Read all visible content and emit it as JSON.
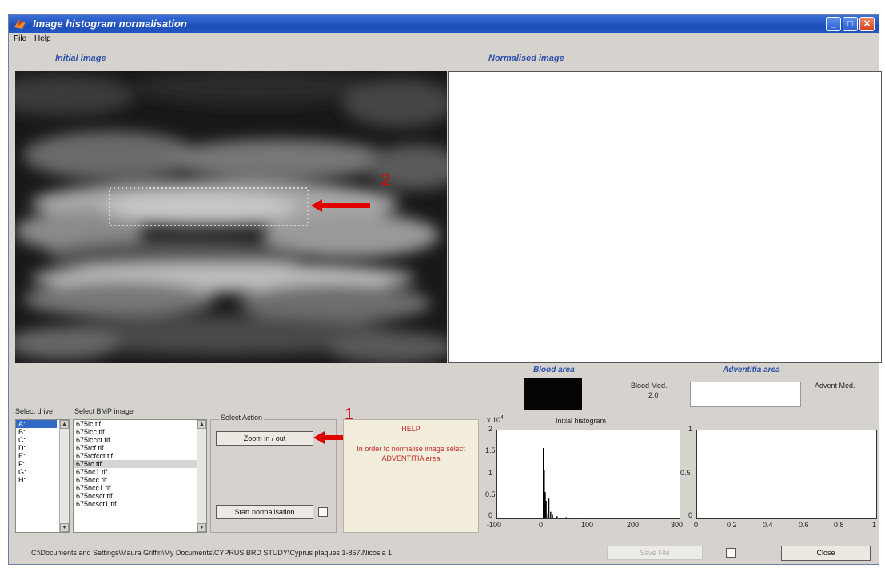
{
  "window": {
    "title": "Image histogram normalisation",
    "menu": [
      "File",
      "Help"
    ]
  },
  "panels": {
    "initial_label": "Initial image",
    "normalised_label": "Normalised image"
  },
  "annotations": {
    "one": "1",
    "two": "2"
  },
  "areas": {
    "blood_label": "Blood area",
    "adventitia_label": "Adventitia area",
    "blood_med_label": "Blood Med.",
    "blood_med_value": "2.0",
    "advent_med_label": "Advent Med."
  },
  "drive": {
    "label": "Select drive",
    "items": [
      "A:",
      "B:",
      "C:",
      "D:",
      "E:",
      "F:",
      "G:",
      "H:"
    ],
    "selected": "A:"
  },
  "bmp": {
    "label": "Select BMP image",
    "items": [
      "675lc.tif",
      "675lcc.tif",
      "675lccct.tif",
      "675rcf.tif",
      "675rcfcct.tif",
      "675rc.tif",
      "675nc1.tif",
      "675ncc.tif",
      "675ncc1.tif",
      "675ncsct.tif",
      "675ncsct1.tif"
    ],
    "selected": "675rc.tif"
  },
  "actions": {
    "label": "Select Action",
    "zoom_button": "Zoom in / out",
    "start_button": "Start normalisation"
  },
  "help": {
    "title": "HELP",
    "text": "In order to normalise image select ADVENTITIA area"
  },
  "histogram": {
    "title": "Initial histogram",
    "exponent": "x 10",
    "exponent_power": "4",
    "y_ticks": [
      "2",
      "1.5",
      "1",
      "0.5",
      "0"
    ],
    "x_ticks": [
      "-100",
      "0",
      "100",
      "200",
      "300"
    ]
  },
  "chart2": {
    "y_ticks": [
      "1",
      "0.5",
      "0"
    ],
    "x_ticks": [
      "0",
      "0.2",
      "0.4",
      "0.6",
      "0.8",
      "1"
    ]
  },
  "footer": {
    "path": "C:\\Documents and Settings\\Maura Griffin\\My Documents\\CYPRUS BRD STUDY\\Cyprus plaques 1-867\\Nicosia 1",
    "save_button": "Save File",
    "close_button": "Close"
  },
  "colors": {
    "red_annotation": "#e00000",
    "title_text": "#2b4fa8",
    "help_text": "#c62828"
  },
  "chart_data": {
    "type": "bar",
    "title": "Initial histogram",
    "xlim": [
      -100,
      300
    ],
    "ylim": [
      0,
      2
    ],
    "y_scale_label": "x 10^4",
    "bars": [
      {
        "x": 0,
        "y": 1.6
      },
      {
        "x": 2,
        "y": 1.1
      },
      {
        "x": 4,
        "y": 0.6
      },
      {
        "x": 6,
        "y": 0.4
      },
      {
        "x": 10,
        "y": 0.1
      },
      {
        "x": 12,
        "y": 0.45
      },
      {
        "x": 16,
        "y": 0.15
      },
      {
        "x": 20,
        "y": 0.08
      },
      {
        "x": 30,
        "y": 0.05
      },
      {
        "x": 50,
        "y": 0.03
      },
      {
        "x": 80,
        "y": 0.02
      },
      {
        "x": 120,
        "y": 0.015
      },
      {
        "x": 180,
        "y": 0.01
      },
      {
        "x": 250,
        "y": 0.008
      }
    ]
  }
}
